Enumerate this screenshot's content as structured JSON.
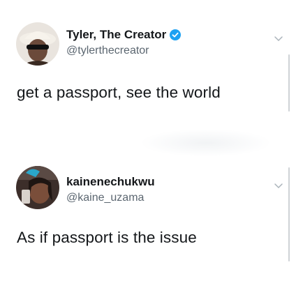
{
  "tweets": [
    {
      "display_name": "Tyler, The Creator",
      "handle": "@tylerthecreator",
      "verified": true,
      "text": "get a passport, see the world"
    },
    {
      "display_name": "kainenechukwu",
      "handle": "@kaine_uzama",
      "verified": false,
      "text": "As if passport is the issue"
    }
  ],
  "colors": {
    "verified_blue": "#1da1f2",
    "handle_gray": "#5b6670",
    "text_dark": "#14171a"
  },
  "icons": {
    "verified": "verified-badge-icon",
    "menu": "chevron-down-icon"
  }
}
